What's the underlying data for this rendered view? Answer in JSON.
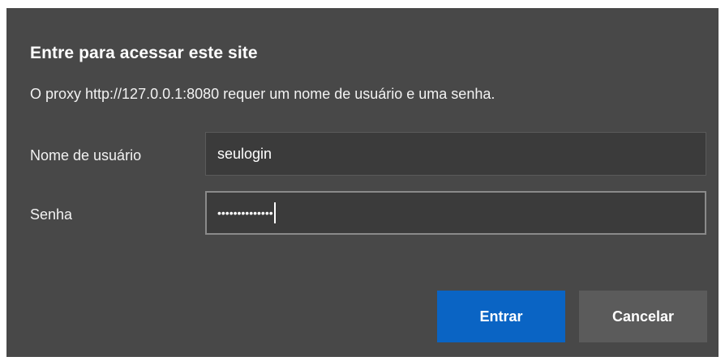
{
  "dialog": {
    "title": "Entre para acessar este site",
    "message": "O proxy http://127.0.0.1:8080 requer um nome de usuário e uma senha.",
    "username_label": "Nome de usuário",
    "username_value": "seulogin",
    "password_label": "Senha",
    "password_mask": "••••••••••••••",
    "submit_label": "Entrar",
    "cancel_label": "Cancelar"
  },
  "colors": {
    "background": "#484848",
    "field_background": "#3b3b3b",
    "primary_button": "#0a64c4",
    "secondary_button": "#5b5b5b"
  }
}
